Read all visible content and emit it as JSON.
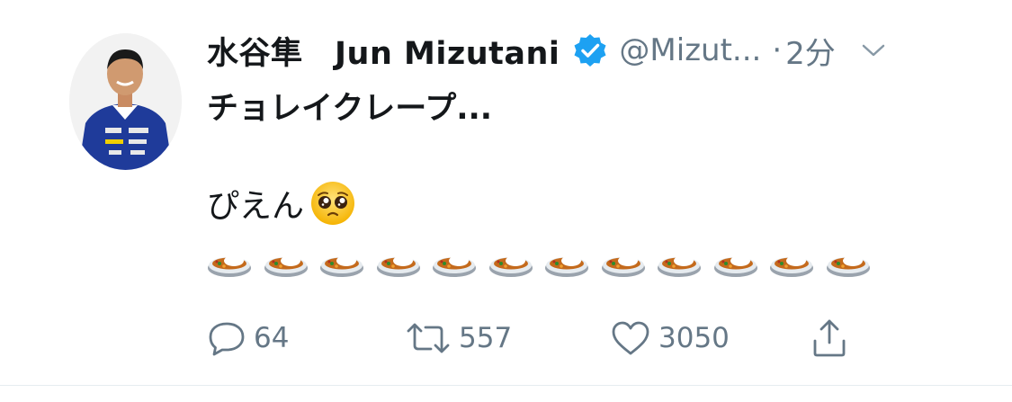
{
  "tweet": {
    "author_name": "水谷隼　Jun Mizutani",
    "handle": "@Mizut...",
    "separator": "·",
    "time": "2分",
    "title": "チョレイクレープ...",
    "body_text": "ぴえん",
    "emoji_pleading": "pleading-face",
    "curry_count": 12
  },
  "actions": {
    "reply_count": "64",
    "retweet_count": "557",
    "like_count": "3050"
  },
  "colors": {
    "text": "#14171a",
    "secondary": "#657786",
    "verified": "#1da1f2"
  }
}
